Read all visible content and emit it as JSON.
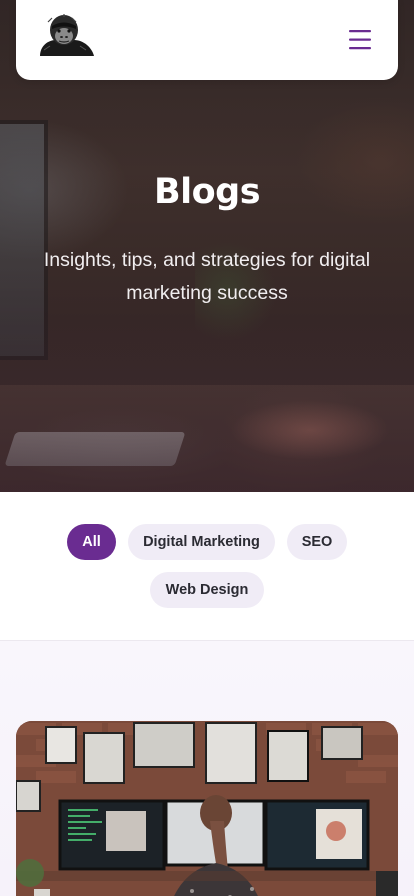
{
  "header": {
    "logo_icon": "gorilla-logo-icon",
    "menu_icon": "hamburger-menu-icon",
    "accent_color": "#6a2c91"
  },
  "hero": {
    "title": "Blogs",
    "subtitle": "Insights, tips, and strategies for digital marketing success"
  },
  "filters": {
    "items": [
      {
        "label": "All",
        "active": true
      },
      {
        "label": "Digital Marketing",
        "active": false
      },
      {
        "label": "SEO",
        "active": false
      },
      {
        "label": "Web Design",
        "active": false
      }
    ],
    "active_color": "#6a2c91",
    "idle_color": "#f0ecf6"
  },
  "blog_card": {
    "image_icon": "woman-at-computers-image"
  }
}
